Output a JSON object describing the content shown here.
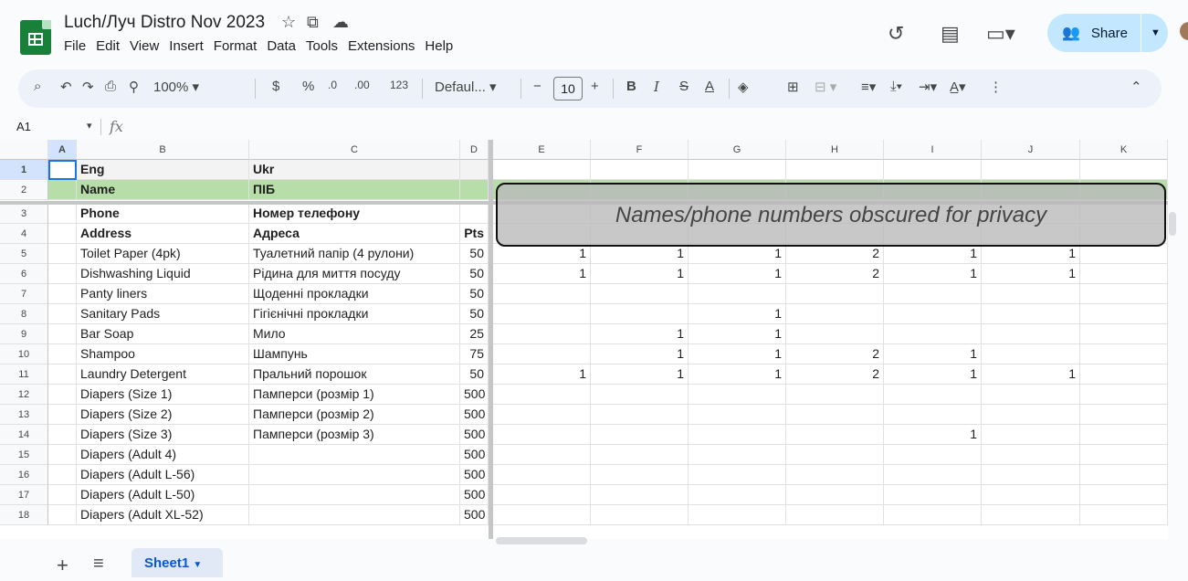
{
  "header": {
    "doc_title": "Luch/Луч Distro Nov 2023",
    "menu": [
      "File",
      "Edit",
      "View",
      "Insert",
      "Format",
      "Data",
      "Tools",
      "Extensions",
      "Help"
    ],
    "share_label": "Share"
  },
  "toolbar": {
    "zoom": "100%",
    "currency": "$",
    "percent": "%",
    "dec_less": ".0",
    "dec_more": ".00",
    "num_format": "123",
    "font": "Defaul...",
    "font_size": "10",
    "bold": "B",
    "italic": "I",
    "strike": "S",
    "text_color": "A"
  },
  "formula_bar": {
    "name_box": "A1",
    "fx": "fx"
  },
  "grid": {
    "columns": [
      "A",
      "B",
      "C",
      "D",
      "E",
      "F",
      "G",
      "H",
      "I",
      "J",
      "K"
    ],
    "rows": [
      {
        "n": "1",
        "b": "Eng",
        "c": "Ukr",
        "d": "",
        "e": "",
        "f": "",
        "g": "",
        "h": "",
        "i": "",
        "j": "",
        "k": ""
      },
      {
        "n": "2",
        "b": "Name",
        "c": "ПІБ",
        "d": "",
        "e": "",
        "f": "",
        "g": "",
        "h": "",
        "i": "",
        "j": "",
        "k": ""
      },
      {
        "n": "3",
        "b": "Phone",
        "c": "Номер телефону",
        "d": "",
        "e": "",
        "f": "",
        "g": "",
        "h": "",
        "i": "",
        "j": "",
        "k": ""
      },
      {
        "n": "4",
        "b": "Address",
        "c": "Адреса",
        "d": "Pts",
        "e": "",
        "f": "",
        "g": "",
        "h": "",
        "i": "",
        "j": "",
        "k": ""
      },
      {
        "n": "5",
        "b": "Toilet Paper (4pk)",
        "c": "Туалетний папір (4 рулони)",
        "d": "50",
        "e": "1",
        "f": "1",
        "g": "1",
        "h": "2",
        "i": "1",
        "j": "1",
        "k": ""
      },
      {
        "n": "6",
        "b": "Dishwashing Liquid",
        "c": "Рідина для миття посуду",
        "d": "50",
        "e": "1",
        "f": "1",
        "g": "1",
        "h": "2",
        "i": "1",
        "j": "1",
        "k": ""
      },
      {
        "n": "7",
        "b": "Panty liners",
        "c": "Щоденні прокладки",
        "d": "50",
        "e": "",
        "f": "",
        "g": "",
        "h": "",
        "i": "",
        "j": "",
        "k": ""
      },
      {
        "n": "8",
        "b": "Sanitary Pads",
        "c": "Гігієнічні прокладки",
        "d": "50",
        "e": "",
        "f": "",
        "g": "1",
        "h": "",
        "i": "",
        "j": "",
        "k": ""
      },
      {
        "n": "9",
        "b": "Bar Soap",
        "c": "Мило",
        "d": "25",
        "e": "",
        "f": "1",
        "g": "1",
        "h": "",
        "i": "",
        "j": "",
        "k": ""
      },
      {
        "n": "10",
        "b": "Shampoo",
        "c": "Шампунь",
        "d": "75",
        "e": "",
        "f": "1",
        "g": "1",
        "h": "2",
        "i": "1",
        "j": "",
        "k": ""
      },
      {
        "n": "11",
        "b": "Laundry Detergent",
        "c": "Пральний порошок",
        "d": "50",
        "e": "1",
        "f": "1",
        "g": "1",
        "h": "2",
        "i": "1",
        "j": "1",
        "k": ""
      },
      {
        "n": "12",
        "b": "Diapers (Size 1)",
        "c": "Памперси (розмір 1)",
        "d": "500",
        "e": "",
        "f": "",
        "g": "",
        "h": "",
        "i": "",
        "j": "",
        "k": ""
      },
      {
        "n": "13",
        "b": "Diapers (Size 2)",
        "c": "Памперси (розмір 2)",
        "d": "500",
        "e": "",
        "f": "",
        "g": "",
        "h": "",
        "i": "",
        "j": "",
        "k": ""
      },
      {
        "n": "14",
        "b": "Diapers (Size 3)",
        "c": "Памперси (розмір 3)",
        "d": "500",
        "e": "",
        "f": "",
        "g": "",
        "h": "",
        "i": "1",
        "j": "",
        "k": ""
      },
      {
        "n": "15",
        "b": "Diapers (Adult 4)",
        "c": "",
        "d": "500",
        "e": "",
        "f": "",
        "g": "",
        "h": "",
        "i": "",
        "j": "",
        "k": ""
      },
      {
        "n": "16",
        "b": "Diapers (Adult L-56)",
        "c": "",
        "d": "500",
        "e": "",
        "f": "",
        "g": "",
        "h": "",
        "i": "",
        "j": "",
        "k": ""
      },
      {
        "n": "17",
        "b": "Diapers (Adult L-50)",
        "c": "",
        "d": "500",
        "e": "",
        "f": "",
        "g": "",
        "h": "",
        "i": "",
        "j": "",
        "k": ""
      },
      {
        "n": "18",
        "b": "Diapers (Adult XL-52)",
        "c": "",
        "d": "500",
        "e": "",
        "f": "",
        "g": "",
        "h": "",
        "i": "",
        "j": "",
        "k": ""
      }
    ]
  },
  "overlay_text": "Names/phone numbers obscured for privacy",
  "sheet_tab": "Sheet1",
  "colors": {
    "header_bg": "#f8f9fa",
    "name_row_bg": "#b7dea8",
    "share_bg": "#c2e7ff",
    "accent": "#0b57d0"
  }
}
